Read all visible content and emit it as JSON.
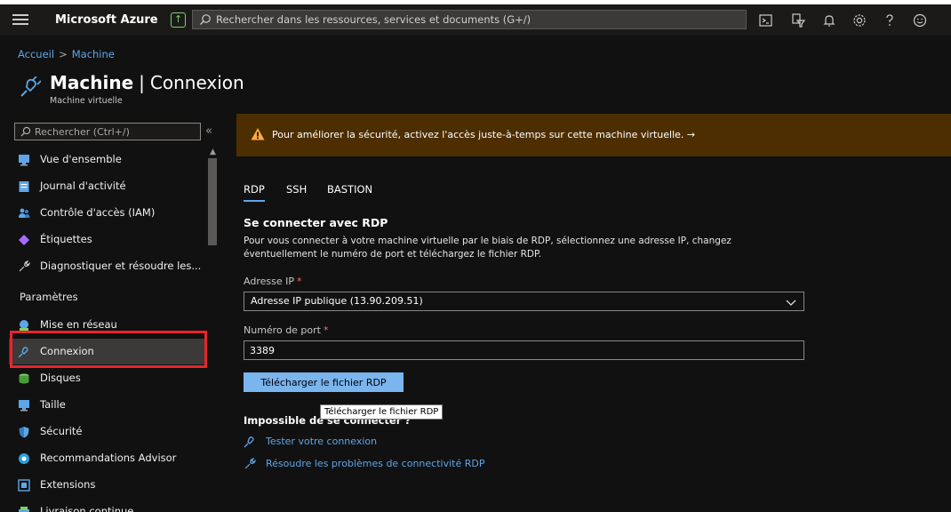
{
  "topbar": {
    "brand": "Microsoft Azure",
    "search_placeholder": "Rechercher dans les ressources, services et documents (G+/)"
  },
  "breadcrumb": {
    "home": "Accueil",
    "current": "Machine"
  },
  "header": {
    "resource": "Machine",
    "blade": "Connexion",
    "subtitle": "Machine virtuelle"
  },
  "sidebar": {
    "search_placeholder": "Rechercher (Ctrl+/)",
    "collapse_label": "«",
    "section_parametres": "Paramètres",
    "items": [
      {
        "label": "Vue d'ensemble",
        "icon": "monitor-icon"
      },
      {
        "label": "Journal d'activité",
        "icon": "log-icon"
      },
      {
        "label": "Contrôle d'accès (IAM)",
        "icon": "people-icon"
      },
      {
        "label": "Étiquettes",
        "icon": "tag-icon"
      },
      {
        "label": "Diagnostiquer et résoudre les...",
        "icon": "wrench-icon"
      },
      {
        "label": "Mise en réseau",
        "icon": "network-icon"
      },
      {
        "label": "Connexion",
        "icon": "connect-icon"
      },
      {
        "label": "Disques",
        "icon": "disk-icon"
      },
      {
        "label": "Taille",
        "icon": "monitor-icon"
      },
      {
        "label": "Sécurité",
        "icon": "shield-icon"
      },
      {
        "label": "Recommandations Advisor",
        "icon": "advisor-icon"
      },
      {
        "label": "Extensions",
        "icon": "extension-icon"
      },
      {
        "label": "Livraison continue",
        "icon": "delivery-icon"
      }
    ]
  },
  "banner": {
    "message": "Pour améliorer la sécurité, activez l'accès juste-à-temps sur cette machine virtuelle. →"
  },
  "tabs": [
    "RDP",
    "SSH",
    "BASTION"
  ],
  "connect": {
    "title": "Se connecter avec RDP",
    "description": "Pour vous connecter à votre machine virtuelle par le biais de RDP, sélectionnez une adresse IP, changez éventuellement le numéro de port et téléchargez le fichier RDP.",
    "ip_label": "Adresse IP",
    "ip_value": "Adresse IP publique (13.90.209.51)",
    "port_label": "Numéro de port",
    "port_value": "3389",
    "required_mark": "*",
    "download_button": "Télécharger le fichier RDP",
    "tooltip": "Télécharger le fichier RDP",
    "cant_connect": "Impossible de se connecter ?",
    "links": [
      "Tester votre connexion",
      "Résoudre les problèmes de connectivité RDP"
    ]
  },
  "colors": {
    "accent": "#5ea6ea",
    "banner": "#4d2e00",
    "highlight": "#e8262a",
    "button": "#7ab5ee"
  }
}
